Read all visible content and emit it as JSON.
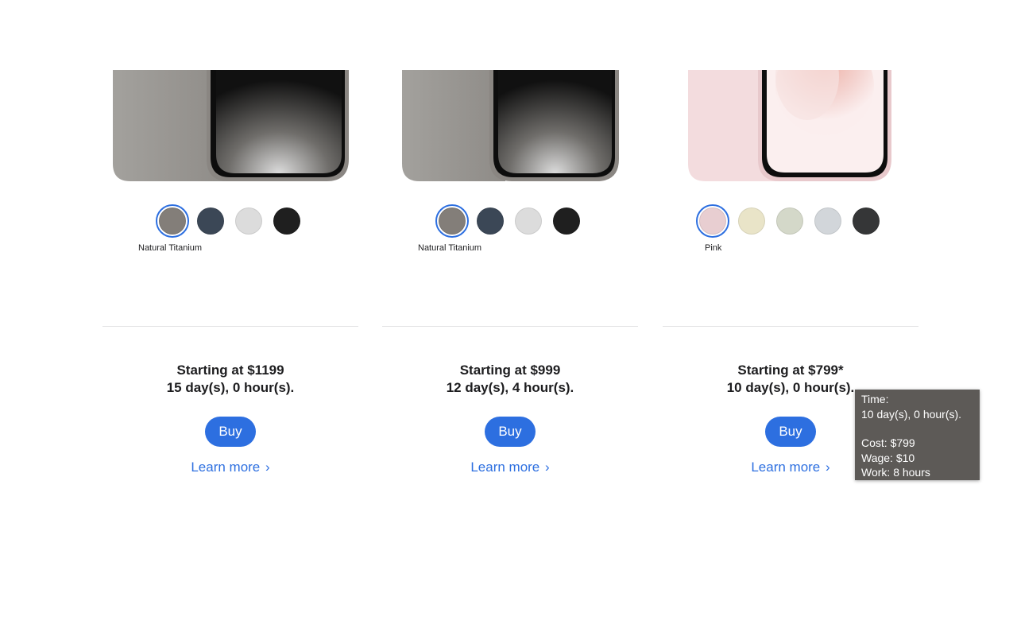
{
  "products": [
    {
      "color_name": "Natural Titanium",
      "swatches": [
        "#837e79",
        "#3b4756",
        "#dcdcdc",
        "#1f1f1f"
      ],
      "selected_swatch": 0,
      "price_text": "Starting at $1199",
      "time_text": "15 day(s), 0 hour(s).",
      "buy_label": "Buy",
      "learn_more_label": "Learn more"
    },
    {
      "color_name": "Natural Titanium",
      "swatches": [
        "#837e79",
        "#3b4756",
        "#dcdcdc",
        "#1f1f1f"
      ],
      "selected_swatch": 0,
      "price_text": "Starting at $999",
      "time_text": "12 day(s), 4 hour(s).",
      "buy_label": "Buy",
      "learn_more_label": "Learn more"
    },
    {
      "color_name": "Pink",
      "swatches": [
        "#e8ced1",
        "#e9e4c8",
        "#d4d8c9",
        "#d2d6da",
        "#353637"
      ],
      "selected_swatch": 0,
      "price_text": "Starting at $799*",
      "time_text": "10 day(s), 0 hour(s).",
      "buy_label": "Buy",
      "learn_more_label": "Learn more"
    }
  ],
  "chevron": "›",
  "tooltip": {
    "time_label": "Time:",
    "time_value": "10 day(s), 0 hour(s).",
    "cost": "Cost: $799",
    "wage": "Wage: $10",
    "work": "Work: 8 hours"
  },
  "colors": {
    "accent": "#2d6fe0",
    "tooltip_bg": "#5d5a57"
  }
}
